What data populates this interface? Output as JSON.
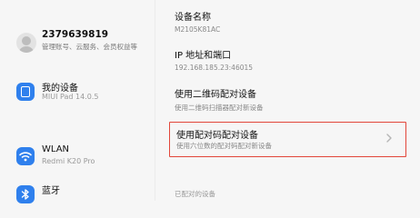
{
  "account": {
    "name": "2379639819",
    "subtitle": "管理账号、云服务、会员权益等"
  },
  "nav": {
    "my_device": {
      "title": "我的设备",
      "subtitle": "MIUI Pad 14.0.5"
    },
    "wlan": {
      "title": "WLAN",
      "subtitle": "Redmi K20 Pro"
    },
    "bluetooth": {
      "title": "蓝牙"
    }
  },
  "details": {
    "device_name": {
      "label": "设备名称",
      "value": "M2105K81AC"
    },
    "ip": {
      "label": "IP 地址和端口",
      "value": "192.168.185.23:46015"
    },
    "qr_pair": {
      "label": "使用二维码配对设备",
      "desc": "使用二维码扫描器配对新设备"
    },
    "code_pair": {
      "label": "使用配对码配对设备",
      "desc": "使用六位数的配对码配对新设备"
    },
    "paired_header": "已配对的设备"
  },
  "colors": {
    "accent": "#2f80ed",
    "highlight_border": "#e2463a"
  }
}
